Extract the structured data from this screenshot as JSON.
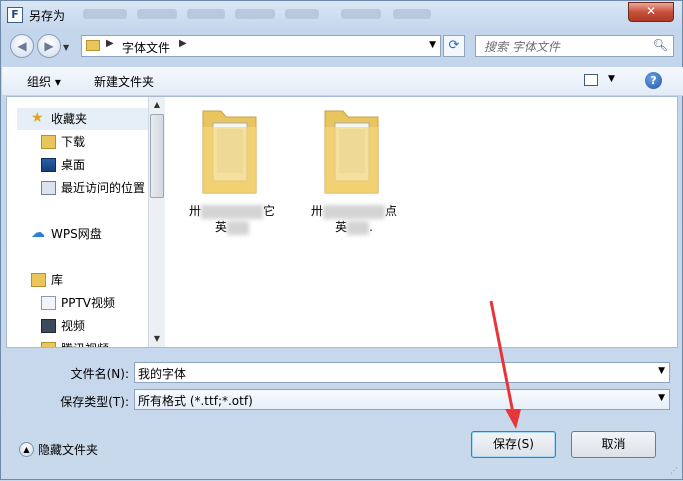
{
  "window": {
    "title": "另存为",
    "close_label": "✕"
  },
  "nav": {
    "back_label": "◀",
    "forward_label": "▶",
    "breadcrumb": [
      "字体文件"
    ],
    "refresh_label": "⟳"
  },
  "search": {
    "placeholder": "搜索 字体文件",
    "icon": "magnifier-icon"
  },
  "toolbar": {
    "organize_label": "组织 ▾",
    "new_folder_label": "新建文件夹",
    "help_label": "?"
  },
  "sidebar": {
    "items": [
      {
        "label": "收藏夹",
        "icon": "star-icon"
      },
      {
        "label": "下载",
        "icon": "download-folder-icon"
      },
      {
        "label": "桌面",
        "icon": "desktop-icon"
      },
      {
        "label": "最近访问的位置",
        "icon": "recent-places-icon"
      },
      {
        "label": "WPS网盘",
        "icon": "cloud-icon"
      },
      {
        "label": "库",
        "icon": "library-icon"
      },
      {
        "label": "PPTV视频",
        "icon": "pptv-icon"
      },
      {
        "label": "视频",
        "icon": "video-icon"
      },
      {
        "label": "腾讯视频",
        "icon": "tencent-video-icon"
      }
    ]
  },
  "files": [
    {
      "name_start": "卅",
      "name_end": "它",
      "line2_start": "英",
      "line2_end": ""
    },
    {
      "name_start": "卅",
      "name_end": "点",
      "line2_start": "英",
      "line2_end": "."
    }
  ],
  "form": {
    "filename_label": "文件名(N):",
    "filename_value": "我的字体",
    "filetype_label": "保存类型(T):",
    "filetype_value": "所有格式 (*.ttf;*.otf)"
  },
  "footer": {
    "hide_folders_label": "隐藏文件夹",
    "save_label": "保存(S)",
    "cancel_label": "取消"
  },
  "colors": {
    "folder": "#f2d06b",
    "annotation_arrow": "#e8353a"
  }
}
